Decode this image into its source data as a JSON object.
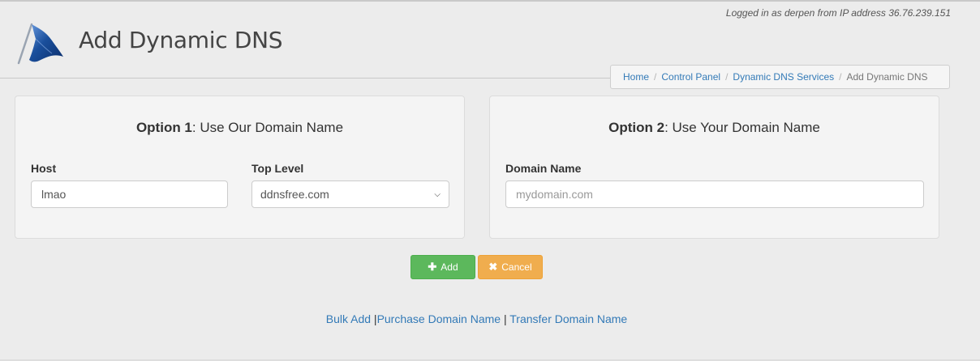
{
  "header": {
    "title": "Add Dynamic DNS",
    "login_info": "Logged in as derpen from IP address 36.76.239.151"
  },
  "breadcrumb": {
    "items": [
      {
        "label": "Home"
      },
      {
        "label": "Control Panel"
      },
      {
        "label": "Dynamic DNS Services"
      }
    ],
    "active": "Add Dynamic DNS"
  },
  "option1": {
    "title_strong": "Option 1",
    "title_rest": ": Use Our Domain Name",
    "host_label": "Host",
    "host_value": "lmao",
    "top_level_label": "Top Level",
    "top_level_selected": "ddnsfree.com"
  },
  "option2": {
    "title_strong": "Option 2",
    "title_rest": ": Use Your Domain Name",
    "domain_label": "Domain Name",
    "domain_placeholder": "mydomain.com"
  },
  "buttons": {
    "add_label": "Add",
    "add_icon": "plus-icon",
    "cancel_label": "Cancel",
    "cancel_icon": "times-icon"
  },
  "footer": {
    "bulk_add": "Bulk Add",
    "purchase": "Purchase Domain Name",
    "transfer": "Transfer Domain Name",
    "separator": "|"
  },
  "colors": {
    "link": "#337ab7",
    "add_button": "#5cb85c",
    "cancel_button": "#f0ad4e",
    "logo_blue": "#1a4f9c"
  }
}
